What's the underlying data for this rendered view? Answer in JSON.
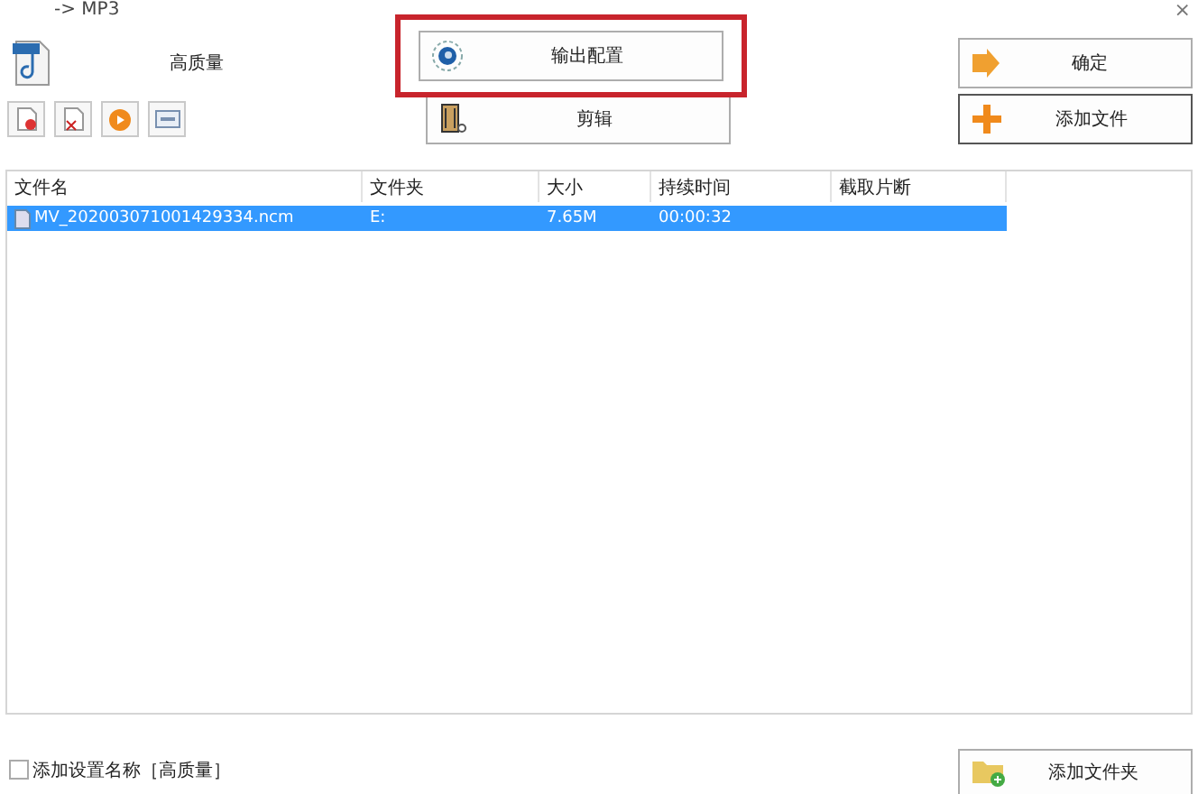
{
  "window": {
    "title": "-> MP3",
    "close": "×"
  },
  "preset": {
    "label": "高质量"
  },
  "buttons": {
    "output_settings": {
      "label": "输出配置",
      "highlighted": true
    },
    "edit": {
      "label": "剪辑"
    },
    "ok": {
      "label": "确定"
    },
    "add_file": {
      "label": "添加文件"
    },
    "add_folder": {
      "label": "添加文件夹"
    }
  },
  "table": {
    "columns": [
      "文件名",
      "文件夹",
      "大小",
      "持续时间",
      "截取片断"
    ],
    "rows": [
      {
        "cells": [
          "MV_202003071001429334.ncm",
          "E:",
          "7.65M",
          "00:00:32"
        ],
        "selected": true
      }
    ]
  },
  "option": {
    "label": "添加设置名称［高质量］",
    "checked": false
  }
}
